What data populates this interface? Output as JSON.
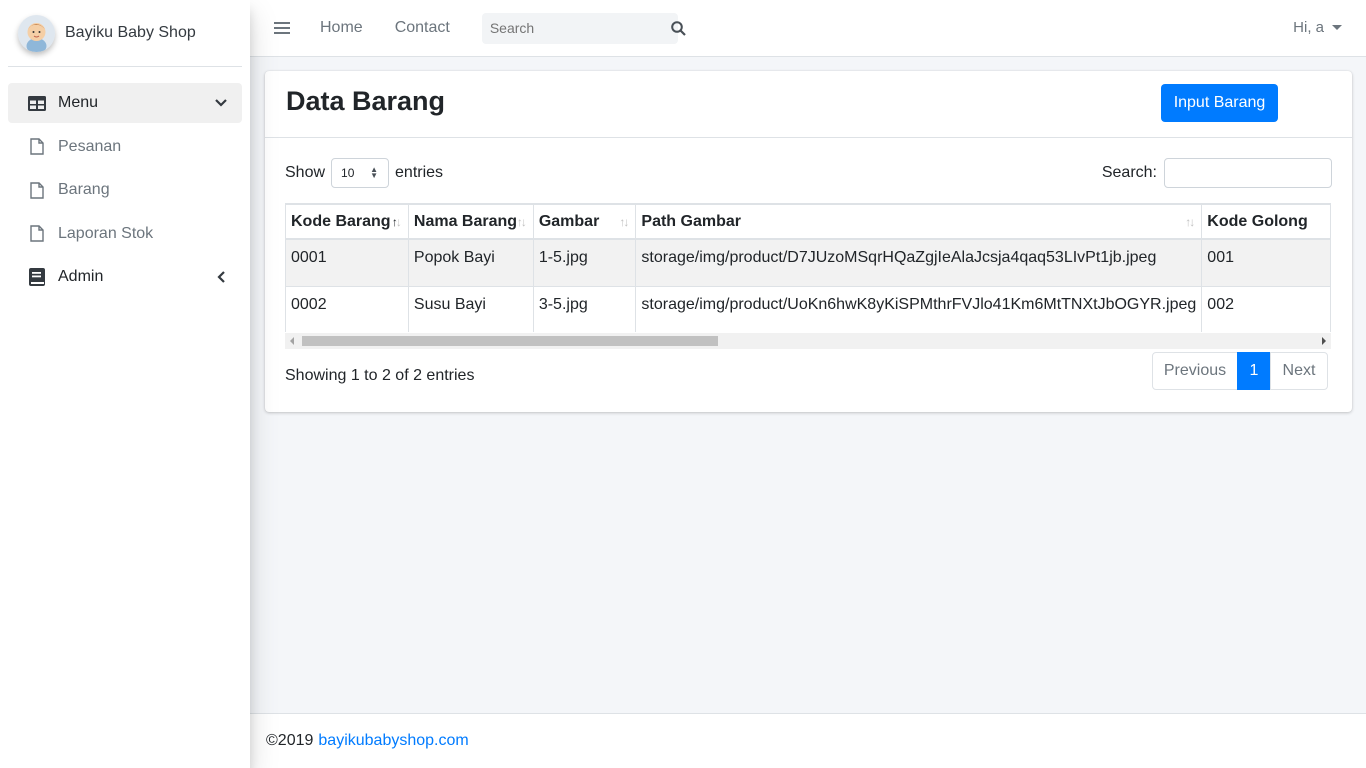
{
  "sidebar": {
    "brand": "Bayiku Baby Shop",
    "items": [
      {
        "label": "Menu",
        "icon": "table-icon",
        "active": true
      },
      {
        "label": "Pesanan",
        "icon": "file-icon"
      },
      {
        "label": "Barang",
        "icon": "file-icon"
      },
      {
        "label": "Laporan Stok",
        "icon": "file-icon"
      },
      {
        "label": "Admin",
        "icon": "book-icon"
      }
    ]
  },
  "topbar": {
    "home": "Home",
    "contact": "Contact",
    "search_placeholder": "Search",
    "user": "Hi, a"
  },
  "card": {
    "title": "Data Barang",
    "input_button": "Input Barang"
  },
  "datatable": {
    "show": "Show",
    "length_value": "10",
    "entries": "entries",
    "search_label": "Search:",
    "columns": [
      "Kode Barang",
      "Nama Barang",
      "Gambar",
      "Path Gambar",
      "Kode Golong"
    ],
    "rows": [
      [
        "0001",
        "Popok Bayi",
        "1-5.jpg",
        "storage/img/product/D7JUzoMSqrHQaZgjIeAlaJcsja4qaq53LIvPt1jb.jpeg",
        "001"
      ],
      [
        "0002",
        "Susu Bayi",
        "3-5.jpg",
        "storage/img/product/UoKn6hwK8yKiSPMthrFVJlo41Km6MtTNXtJbOGYR.jpeg",
        "002"
      ]
    ],
    "info": "Showing 1 to 2 of 2 entries",
    "previous": "Previous",
    "page": "1",
    "next": "Next"
  },
  "footer": {
    "copyright": "©2019",
    "link": "bayikubabyshop.com"
  },
  "colors": {
    "primary": "#007bff",
    "background": "#f4f6f9"
  }
}
